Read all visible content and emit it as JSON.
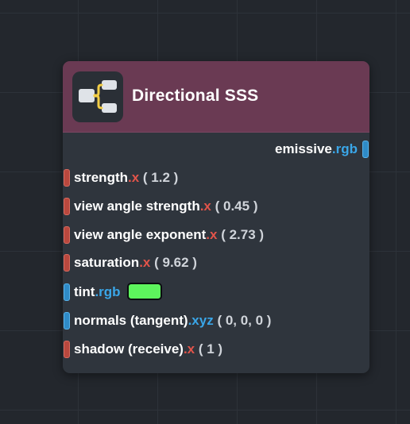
{
  "node": {
    "title": "Directional SSS",
    "icon": "node-branch-icon",
    "colors": {
      "header": "#6a3a53",
      "body": "#2f353d",
      "canvas": "#23272d"
    },
    "outputs": [
      {
        "name": "emissive",
        "suffix": ".rgb",
        "port_type": "vec"
      }
    ],
    "inputs": [
      {
        "name": "strength",
        "suffix": ".x",
        "value": "( 1.2 )",
        "port_type": "x"
      },
      {
        "name": "view angle strength",
        "suffix": ".x",
        "value": "( 0.45 )",
        "port_type": "x"
      },
      {
        "name": "view angle exponent",
        "suffix": ".x",
        "value": "( 2.73 )",
        "port_type": "x"
      },
      {
        "name": "saturation",
        "suffix": ".x",
        "value": "( 9.62 )",
        "port_type": "x"
      },
      {
        "name": "tint",
        "suffix": ".rgb",
        "swatch_color": "#5df45d",
        "port_type": "vec"
      },
      {
        "name": "normals (tangent)",
        "suffix": ".xyz",
        "value": "( 0, 0, 0 )",
        "port_type": "vec"
      },
      {
        "name": "shadow (receive)",
        "suffix": ".x",
        "value": "( 1 )",
        "port_type": "x"
      }
    ]
  }
}
